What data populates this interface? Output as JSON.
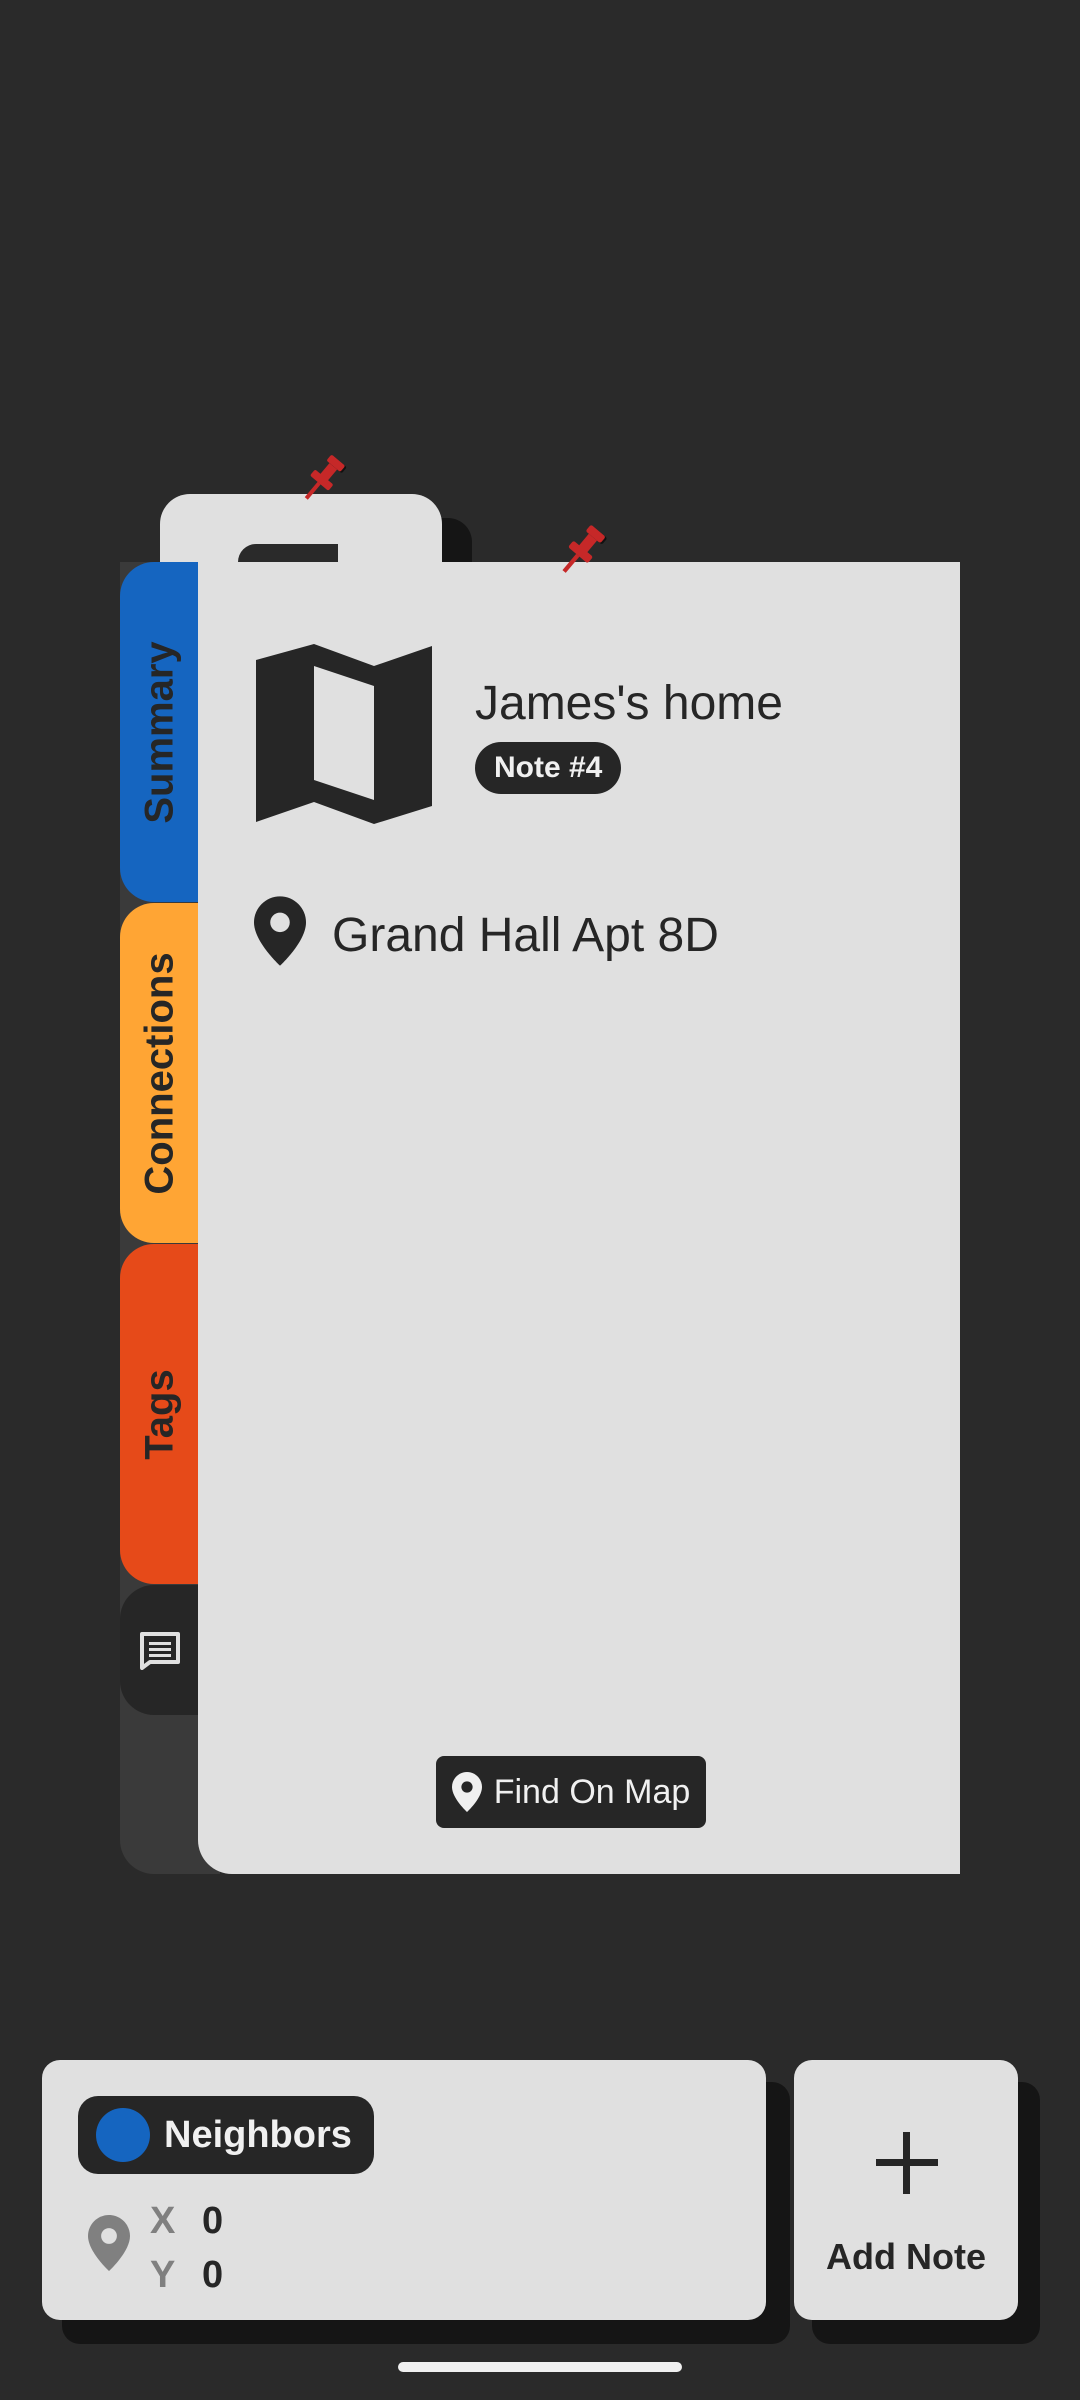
{
  "tabs": {
    "summary": "Summary",
    "connections": "Connections",
    "tags": "Tags",
    "list_icon": "list-icon"
  },
  "note": {
    "title": "James's home",
    "badge": "Note #4",
    "icon": "map-icon",
    "address": "Grand Hall Apt 8D",
    "find_on_map": "Find On Map"
  },
  "group": {
    "name": "Neighbors",
    "color": "#1565c0",
    "x_label": "X",
    "y_label": "Y",
    "x_value": "0",
    "y_value": "0"
  },
  "add_note": {
    "label": "Add Note",
    "icon": "plus-icon"
  },
  "colors": {
    "background": "#2a2a2a",
    "card": "#e0e0e0",
    "summary_tab": "#1565c0",
    "connections_tab": "#ffa534",
    "tags_tab": "#e64a19",
    "pin": "#c62828"
  }
}
